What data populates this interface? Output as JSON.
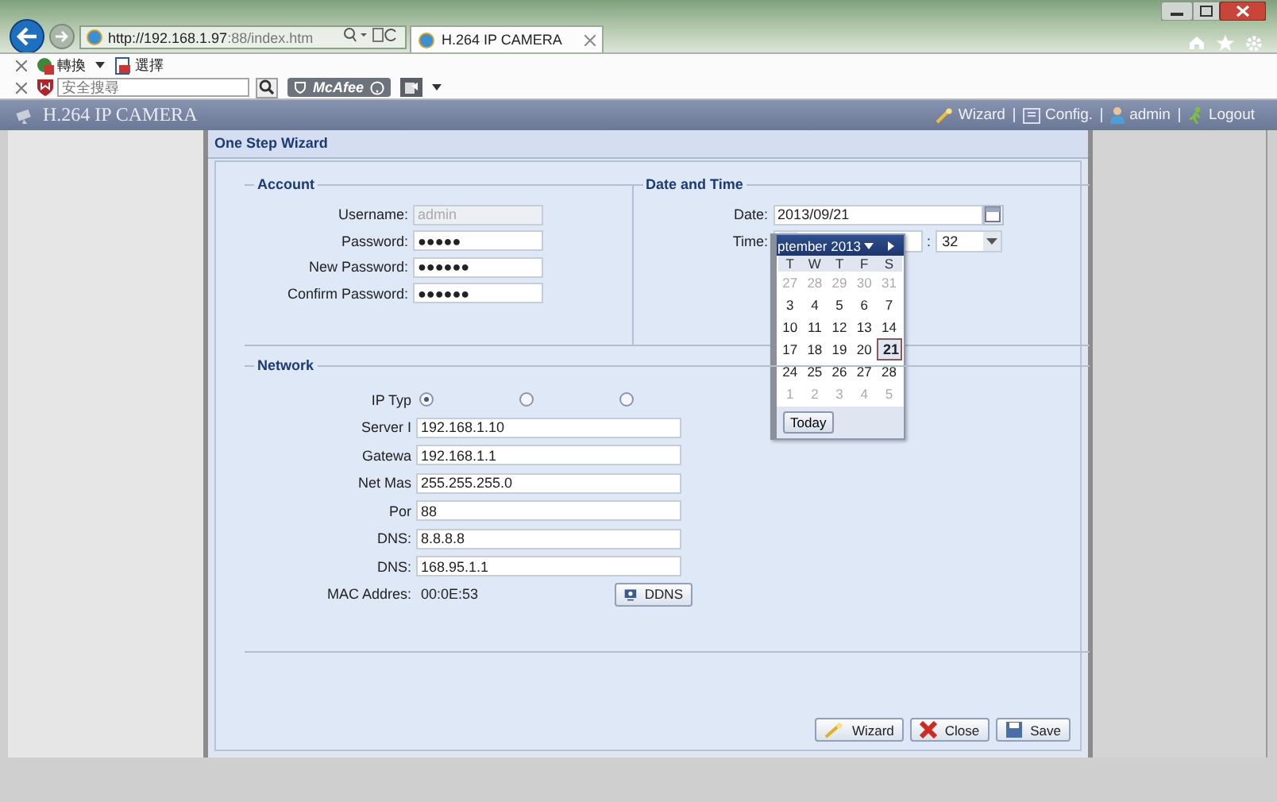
{
  "browser": {
    "address": {
      "host": "http://192.168.1.97",
      "rest": ":88/index.htm"
    },
    "tab_title": "H.264 IP CAMERA",
    "toolbar": [
      {
        "label": "轉換",
        "kind": "translate"
      },
      {
        "label": "選擇",
        "kind": "select"
      }
    ],
    "search": {
      "placeholder": "安全搜尋"
    },
    "mcafee": "McAfee"
  },
  "app_header": {
    "title": "H.264 IP CAMERA",
    "nav": [
      {
        "label": "Wizard",
        "kind": "wizard"
      },
      {
        "label": "Config.",
        "kind": "config"
      },
      {
        "label": "admin",
        "kind": "user"
      },
      {
        "label": "Logout",
        "kind": "logout"
      }
    ]
  },
  "dialog": {
    "title": "One Step Wizard",
    "account": {
      "legend": "Account",
      "fields": [
        {
          "label": "Username:",
          "value": "admin",
          "disabled": true
        },
        {
          "label": "Password:",
          "value": "●●●●●",
          "disabled": false
        },
        {
          "label": "New Password:",
          "value": "●●●●●●",
          "disabled": false
        },
        {
          "label": "Confirm Password:",
          "value": "●●●●●●",
          "disabled": false
        }
      ]
    },
    "date_time": {
      "legend": "Date and Time",
      "date_label": "Date:",
      "date_value": "2013/09/21",
      "time_label": "Time:",
      "separator": ":",
      "minute": "32"
    },
    "calendar": {
      "month": "ptember 2013",
      "weekdays": [
        "T",
        "W",
        "T",
        "F",
        "S"
      ],
      "weeks": [
        [
          {
            "day": "27",
            "other_month": true,
            "selected": false
          },
          {
            "day": "28",
            "other_month": true,
            "selected": false
          },
          {
            "day": "29",
            "other_month": true,
            "selected": false
          },
          {
            "day": "30",
            "other_month": true,
            "selected": false
          },
          {
            "day": "31",
            "other_month": true,
            "selected": false
          }
        ],
        [
          {
            "day": "3",
            "other_month": false,
            "selected": false
          },
          {
            "day": "4",
            "other_month": false,
            "selected": false
          },
          {
            "day": "5",
            "other_month": false,
            "selected": false
          },
          {
            "day": "6",
            "other_month": false,
            "selected": false
          },
          {
            "day": "7",
            "other_month": false,
            "selected": false
          }
        ],
        [
          {
            "day": "10",
            "other_month": false,
            "selected": false
          },
          {
            "day": "11",
            "other_month": false,
            "selected": false
          },
          {
            "day": "12",
            "other_month": false,
            "selected": false
          },
          {
            "day": "13",
            "other_month": false,
            "selected": false
          },
          {
            "day": "14",
            "other_month": false,
            "selected": false
          }
        ],
        [
          {
            "day": "17",
            "other_month": false,
            "selected": false
          },
          {
            "day": "18",
            "other_month": false,
            "selected": false
          },
          {
            "day": "19",
            "other_month": false,
            "selected": false
          },
          {
            "day": "20",
            "other_month": false,
            "selected": false
          },
          {
            "day": "21",
            "other_month": false,
            "selected": true
          }
        ],
        [
          {
            "day": "24",
            "other_month": false,
            "selected": false
          },
          {
            "day": "25",
            "other_month": false,
            "selected": false
          },
          {
            "day": "26",
            "other_month": false,
            "selected": false
          },
          {
            "day": "27",
            "other_month": false,
            "selected": false
          },
          {
            "day": "28",
            "other_month": false,
            "selected": false
          }
        ],
        [
          {
            "day": "1",
            "other_month": true,
            "selected": false
          },
          {
            "day": "2",
            "other_month": true,
            "selected": false
          },
          {
            "day": "3",
            "other_month": true,
            "selected": false
          },
          {
            "day": "4",
            "other_month": true,
            "selected": false
          },
          {
            "day": "5",
            "other_month": true,
            "selected": false
          }
        ]
      ],
      "today_button": "Today"
    },
    "network": {
      "legend": "Network",
      "ip_type_label": "IP Typ",
      "ip_type_options": [
        {
          "selected": true
        },
        {
          "selected": false
        },
        {
          "selected": false
        }
      ],
      "fields": [
        {
          "label": "Server I",
          "value": "192.168.1.10"
        },
        {
          "label": "Gatewa",
          "value": "192.168.1.1"
        },
        {
          "label": "Net Mas",
          "value": "255.255.255.0"
        },
        {
          "label": "Por",
          "value": "88"
        },
        {
          "label": "DNS:",
          "value": "8.8.8.8"
        },
        {
          "label": "DNS:",
          "value": "168.95.1.1"
        }
      ],
      "mac_label": "MAC Addres:",
      "mac_value": "00:0E:53",
      "ddns_button": "DDNS"
    },
    "buttons": [
      {
        "label": "Wizard",
        "kind": "wizard"
      },
      {
        "label": "Close",
        "kind": "close"
      },
      {
        "label": "Save",
        "kind": "save"
      }
    ]
  }
}
